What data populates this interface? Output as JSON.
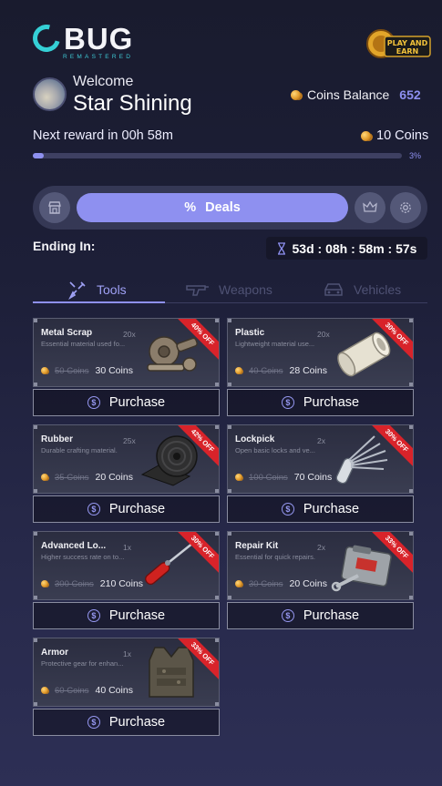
{
  "brand": {
    "name": "BUG",
    "subtitle": "REMASTERED",
    "badge_text": "PLAY AND EARN"
  },
  "user": {
    "welcome": "Welcome",
    "name": "Star Shining"
  },
  "balance": {
    "label": "Coins Balance",
    "value": "652"
  },
  "reward": {
    "label": "Next reward in 00h 58m",
    "amount": "10 Coins",
    "progress_fraction": 0.03,
    "progress_text": "3%"
  },
  "nav": {
    "deals_label": "Deals"
  },
  "timer": {
    "label": "Ending In:",
    "value": "53d : 08h : 58m : 57s"
  },
  "categories": [
    {
      "label": "Tools",
      "active": true
    },
    {
      "label": "Weapons",
      "active": false
    },
    {
      "label": "Vehicles",
      "active": false
    }
  ],
  "items": [
    {
      "name": "Metal Scrap",
      "qty": "20x",
      "desc": "Essential material used fo...",
      "old_price": "50 Coins",
      "price": "30 Coins",
      "discount": "40% OFF",
      "button": "Purchase",
      "icon": "metal-scrap-icon"
    },
    {
      "name": "Plastic",
      "qty": "20x",
      "desc": "Lightweight material use...",
      "old_price": "40 Coins",
      "price": "28 Coins",
      "discount": "30% OFF",
      "button": "Purchase",
      "icon": "plastic-pipe-icon"
    },
    {
      "name": "Rubber",
      "qty": "25x",
      "desc": "Durable crafting material.",
      "old_price": "35 Coins",
      "price": "20 Coins",
      "discount": "42% OFF",
      "button": "Purchase",
      "icon": "rubber-roll-icon"
    },
    {
      "name": "Lockpick",
      "qty": "2x",
      "desc": "Open basic locks and ve...",
      "old_price": "100 Coins",
      "price": "70 Coins",
      "discount": "30% OFF",
      "button": "Purchase",
      "icon": "lockpick-icon"
    },
    {
      "name": "Advanced Lo...",
      "qty": "1x",
      "desc": "Higher success rate on to...",
      "old_price": "300 Coins",
      "price": "210 Coins",
      "discount": "30% OFF",
      "button": "Purchase",
      "icon": "advanced-lockpick-icon"
    },
    {
      "name": "Repair Kit",
      "qty": "2x",
      "desc": "Essential for quick repairs.",
      "old_price": "30 Coins",
      "price": "20 Coins",
      "discount": "33% OFF",
      "button": "Purchase",
      "icon": "repair-kit-icon"
    },
    {
      "name": "Armor",
      "qty": "1x",
      "desc": "Protective gear for enhan...",
      "old_price": "60 Coins",
      "price": "40 Coins",
      "discount": "33% OFF",
      "button": "Purchase",
      "icon": "armor-vest-icon"
    }
  ]
}
